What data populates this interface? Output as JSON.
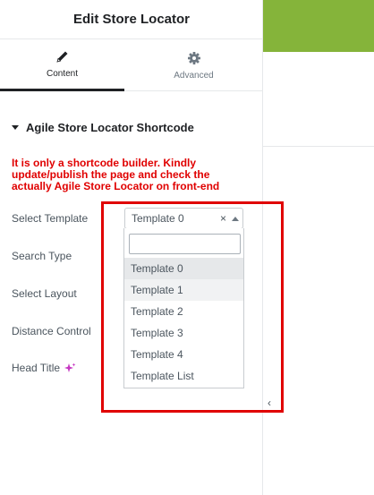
{
  "header": {
    "title": "Edit Store Locator"
  },
  "tabs": [
    {
      "label": "Content",
      "icon": "pencil-icon",
      "active": true
    },
    {
      "label": "Advanced",
      "icon": "gear-icon",
      "active": false
    }
  ],
  "section": {
    "title": "Agile Store Locator Shortcode"
  },
  "warning": {
    "line1": "It is only a shortcode builder. Kindly",
    "line2": "update/publish the page and check the",
    "line3": "actually Agile Store Locator on front-end"
  },
  "fields": {
    "select_template": "Select Template",
    "search_type": "Search Type",
    "select_layout": "Select Layout",
    "distance_control": "Distance Control",
    "head_title": "Head Title"
  },
  "template_select": {
    "value": "Template 0",
    "clear": "×",
    "search_value": "",
    "options": [
      "Template 0",
      "Template 1",
      "Template 2",
      "Template 3",
      "Template 4",
      "Template List"
    ]
  },
  "collapse": {
    "label": "‹"
  },
  "colors": {
    "accent_green": "#85b43a",
    "warning_red": "#e00000",
    "ai_icon": "#c537c1"
  }
}
